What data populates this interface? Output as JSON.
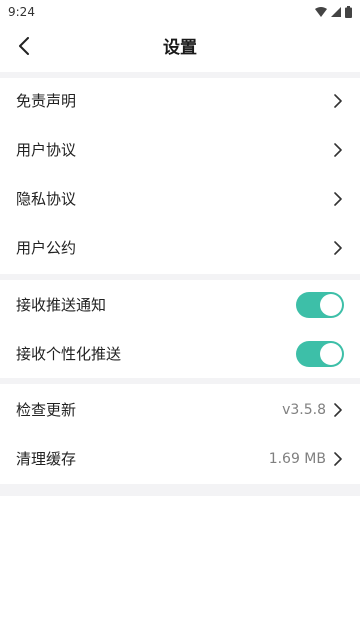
{
  "status_bar": {
    "time": "9:24",
    "icons": [
      "wifi-icon",
      "signal-icon",
      "battery-icon"
    ]
  },
  "header": {
    "back_icon": "back-chevron-icon",
    "title": "设置"
  },
  "section_legal": {
    "items": [
      {
        "label": "免责声明"
      },
      {
        "label": "用户协议"
      },
      {
        "label": "隐私协议"
      },
      {
        "label": "用户公约"
      }
    ]
  },
  "section_push": {
    "items": [
      {
        "label": "接收推送通知",
        "enabled": true
      },
      {
        "label": "接收个性化推送",
        "enabled": true
      }
    ]
  },
  "section_app": {
    "items": [
      {
        "label": "检查更新",
        "value": "v3.5.8"
      },
      {
        "label": "清理缓存",
        "value": "1.69 MB"
      }
    ]
  },
  "colors": {
    "toggle_on": "#3dbfa8",
    "section_gap": "#f3f3f5"
  }
}
